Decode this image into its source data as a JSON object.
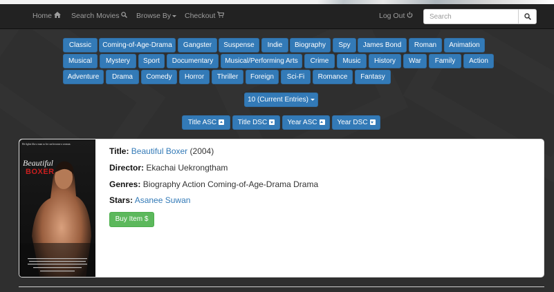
{
  "nav": {
    "home": "Home",
    "search_movies": "Search Movies",
    "browse_by": "Browse By",
    "checkout": "Checkout",
    "logout": "Log Out",
    "search_placeholder": "Search"
  },
  "genres": [
    "Classic",
    "Coming-of-Age-Drama",
    "Gangster",
    "Suspense",
    "Indie",
    "Biography",
    "Spy",
    "James Bond",
    "Roman",
    "Animation",
    "Musical",
    "Mystery",
    "Sport",
    "Documentary",
    "Musical/Performing Arts",
    "Crime",
    "Music",
    "History",
    "War",
    "Family",
    "Action",
    "Adventure",
    "Drama",
    "Comedy",
    "Horror",
    "Thriller",
    "Foreign",
    "Sci-Fi",
    "Romance",
    "Fantasy"
  ],
  "entries_dropdown": "10 (Current Entries)",
  "sort_buttons": [
    "Title ASC",
    "Title DSC",
    "Year ASC",
    "Year DSC"
  ],
  "movie": {
    "title_label": "Title:",
    "title": "Beautiful Boxer",
    "year": "(2004)",
    "director_label": "Director:",
    "director": "Ekachai Uekrongtham",
    "genres_label": "Genres:",
    "genres": "Biography Action Coming-of-Age-Drama Drama",
    "stars_label": "Stars:",
    "stars": "Asanee Suwan",
    "buy_label": "Buy Item $",
    "poster_tagline": "He fights like a man so he can become a woman.",
    "poster_title_1": "Beautiful",
    "poster_title_2": "BOXER"
  },
  "colors": {
    "primary": "#337ab7",
    "success": "#5cb85c",
    "navbar": "#222222",
    "background": "#2f2f2f"
  }
}
